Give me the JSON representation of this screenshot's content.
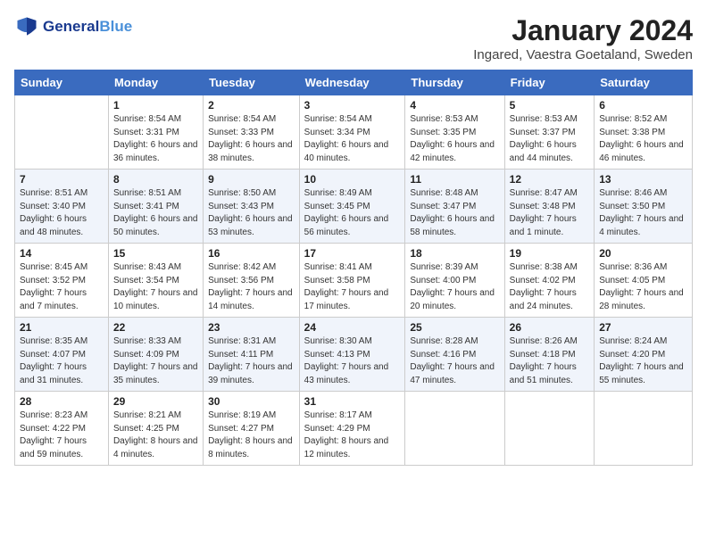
{
  "header": {
    "logo_line1": "General",
    "logo_line2": "Blue",
    "title": "January 2024",
    "subtitle": "Ingared, Vaestra Goetaland, Sweden"
  },
  "days_of_week": [
    "Sunday",
    "Monday",
    "Tuesday",
    "Wednesday",
    "Thursday",
    "Friday",
    "Saturday"
  ],
  "weeks": [
    [
      {
        "day": "",
        "sunrise": "",
        "sunset": "",
        "daylight": ""
      },
      {
        "day": "1",
        "sunrise": "Sunrise: 8:54 AM",
        "sunset": "Sunset: 3:31 PM",
        "daylight": "Daylight: 6 hours and 36 minutes."
      },
      {
        "day": "2",
        "sunrise": "Sunrise: 8:54 AM",
        "sunset": "Sunset: 3:33 PM",
        "daylight": "Daylight: 6 hours and 38 minutes."
      },
      {
        "day": "3",
        "sunrise": "Sunrise: 8:54 AM",
        "sunset": "Sunset: 3:34 PM",
        "daylight": "Daylight: 6 hours and 40 minutes."
      },
      {
        "day": "4",
        "sunrise": "Sunrise: 8:53 AM",
        "sunset": "Sunset: 3:35 PM",
        "daylight": "Daylight: 6 hours and 42 minutes."
      },
      {
        "day": "5",
        "sunrise": "Sunrise: 8:53 AM",
        "sunset": "Sunset: 3:37 PM",
        "daylight": "Daylight: 6 hours and 44 minutes."
      },
      {
        "day": "6",
        "sunrise": "Sunrise: 8:52 AM",
        "sunset": "Sunset: 3:38 PM",
        "daylight": "Daylight: 6 hours and 46 minutes."
      }
    ],
    [
      {
        "day": "7",
        "sunrise": "Sunrise: 8:51 AM",
        "sunset": "Sunset: 3:40 PM",
        "daylight": "Daylight: 6 hours and 48 minutes."
      },
      {
        "day": "8",
        "sunrise": "Sunrise: 8:51 AM",
        "sunset": "Sunset: 3:41 PM",
        "daylight": "Daylight: 6 hours and 50 minutes."
      },
      {
        "day": "9",
        "sunrise": "Sunrise: 8:50 AM",
        "sunset": "Sunset: 3:43 PM",
        "daylight": "Daylight: 6 hours and 53 minutes."
      },
      {
        "day": "10",
        "sunrise": "Sunrise: 8:49 AM",
        "sunset": "Sunset: 3:45 PM",
        "daylight": "Daylight: 6 hours and 56 minutes."
      },
      {
        "day": "11",
        "sunrise": "Sunrise: 8:48 AM",
        "sunset": "Sunset: 3:47 PM",
        "daylight": "Daylight: 6 hours and 58 minutes."
      },
      {
        "day": "12",
        "sunrise": "Sunrise: 8:47 AM",
        "sunset": "Sunset: 3:48 PM",
        "daylight": "Daylight: 7 hours and 1 minute."
      },
      {
        "day": "13",
        "sunrise": "Sunrise: 8:46 AM",
        "sunset": "Sunset: 3:50 PM",
        "daylight": "Daylight: 7 hours and 4 minutes."
      }
    ],
    [
      {
        "day": "14",
        "sunrise": "Sunrise: 8:45 AM",
        "sunset": "Sunset: 3:52 PM",
        "daylight": "Daylight: 7 hours and 7 minutes."
      },
      {
        "day": "15",
        "sunrise": "Sunrise: 8:43 AM",
        "sunset": "Sunset: 3:54 PM",
        "daylight": "Daylight: 7 hours and 10 minutes."
      },
      {
        "day": "16",
        "sunrise": "Sunrise: 8:42 AM",
        "sunset": "Sunset: 3:56 PM",
        "daylight": "Daylight: 7 hours and 14 minutes."
      },
      {
        "day": "17",
        "sunrise": "Sunrise: 8:41 AM",
        "sunset": "Sunset: 3:58 PM",
        "daylight": "Daylight: 7 hours and 17 minutes."
      },
      {
        "day": "18",
        "sunrise": "Sunrise: 8:39 AM",
        "sunset": "Sunset: 4:00 PM",
        "daylight": "Daylight: 7 hours and 20 minutes."
      },
      {
        "day": "19",
        "sunrise": "Sunrise: 8:38 AM",
        "sunset": "Sunset: 4:02 PM",
        "daylight": "Daylight: 7 hours and 24 minutes."
      },
      {
        "day": "20",
        "sunrise": "Sunrise: 8:36 AM",
        "sunset": "Sunset: 4:05 PM",
        "daylight": "Daylight: 7 hours and 28 minutes."
      }
    ],
    [
      {
        "day": "21",
        "sunrise": "Sunrise: 8:35 AM",
        "sunset": "Sunset: 4:07 PM",
        "daylight": "Daylight: 7 hours and 31 minutes."
      },
      {
        "day": "22",
        "sunrise": "Sunrise: 8:33 AM",
        "sunset": "Sunset: 4:09 PM",
        "daylight": "Daylight: 7 hours and 35 minutes."
      },
      {
        "day": "23",
        "sunrise": "Sunrise: 8:31 AM",
        "sunset": "Sunset: 4:11 PM",
        "daylight": "Daylight: 7 hours and 39 minutes."
      },
      {
        "day": "24",
        "sunrise": "Sunrise: 8:30 AM",
        "sunset": "Sunset: 4:13 PM",
        "daylight": "Daylight: 7 hours and 43 minutes."
      },
      {
        "day": "25",
        "sunrise": "Sunrise: 8:28 AM",
        "sunset": "Sunset: 4:16 PM",
        "daylight": "Daylight: 7 hours and 47 minutes."
      },
      {
        "day": "26",
        "sunrise": "Sunrise: 8:26 AM",
        "sunset": "Sunset: 4:18 PM",
        "daylight": "Daylight: 7 hours and 51 minutes."
      },
      {
        "day": "27",
        "sunrise": "Sunrise: 8:24 AM",
        "sunset": "Sunset: 4:20 PM",
        "daylight": "Daylight: 7 hours and 55 minutes."
      }
    ],
    [
      {
        "day": "28",
        "sunrise": "Sunrise: 8:23 AM",
        "sunset": "Sunset: 4:22 PM",
        "daylight": "Daylight: 7 hours and 59 minutes."
      },
      {
        "day": "29",
        "sunrise": "Sunrise: 8:21 AM",
        "sunset": "Sunset: 4:25 PM",
        "daylight": "Daylight: 8 hours and 4 minutes."
      },
      {
        "day": "30",
        "sunrise": "Sunrise: 8:19 AM",
        "sunset": "Sunset: 4:27 PM",
        "daylight": "Daylight: 8 hours and 8 minutes."
      },
      {
        "day": "31",
        "sunrise": "Sunrise: 8:17 AM",
        "sunset": "Sunset: 4:29 PM",
        "daylight": "Daylight: 8 hours and 12 minutes."
      },
      {
        "day": "",
        "sunrise": "",
        "sunset": "",
        "daylight": ""
      },
      {
        "day": "",
        "sunrise": "",
        "sunset": "",
        "daylight": ""
      },
      {
        "day": "",
        "sunrise": "",
        "sunset": "",
        "daylight": ""
      }
    ]
  ]
}
